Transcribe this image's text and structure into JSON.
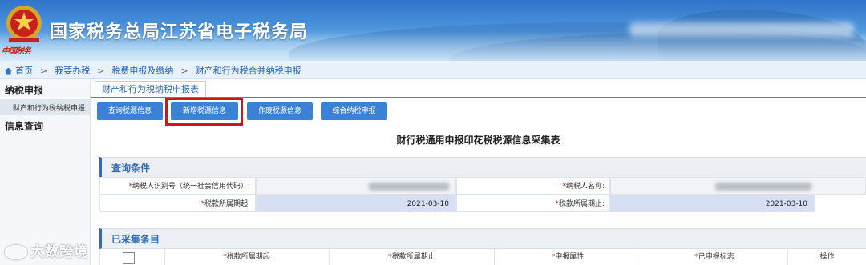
{
  "header": {
    "site_title": "国家税务总局江苏省电子税务局",
    "emblem_text": "中国税务"
  },
  "breadcrumb": {
    "items": [
      "首页",
      "我要办税",
      "税费申报及缴纳",
      "财产和行为税合并纳税申报"
    ],
    "separator": ">"
  },
  "sidebar": {
    "sections": [
      {
        "title": "纳税申报",
        "items": [
          "财产和行为税纳税申报"
        ]
      },
      {
        "title": "信息查询",
        "items": []
      }
    ]
  },
  "tab": {
    "label": "财产和行为税纳税申报表"
  },
  "toolbar": {
    "buttons": [
      "查询税源信息",
      "新增税源信息",
      "作废税源信息",
      "综合纳税申报"
    ],
    "highlighted": "新增税源信息"
  },
  "form": {
    "title": "财行税通用申报印花税税源信息采集表",
    "query_section": "查询条件",
    "fields": {
      "taxpayer_id_label": "纳税人识别号（统一社会信用代码）:",
      "taxpayer_name_label": "纳税人名称:",
      "period_start_label": "税款所属期起:",
      "period_start_value": "2021-03-10",
      "period_end_label": "税款所属期止:",
      "period_end_value": "2021-03-10"
    },
    "collected_section": "已采集条目",
    "columns": [
      "税款所属期起",
      "税款所属期止",
      "申报属性",
      "已申报标志",
      "操作"
    ]
  },
  "watermark": {
    "text": "大数跨境"
  },
  "colors": {
    "accent": "#3b82d6",
    "highlight": "#c81a1a",
    "required": "#d21d1d"
  }
}
